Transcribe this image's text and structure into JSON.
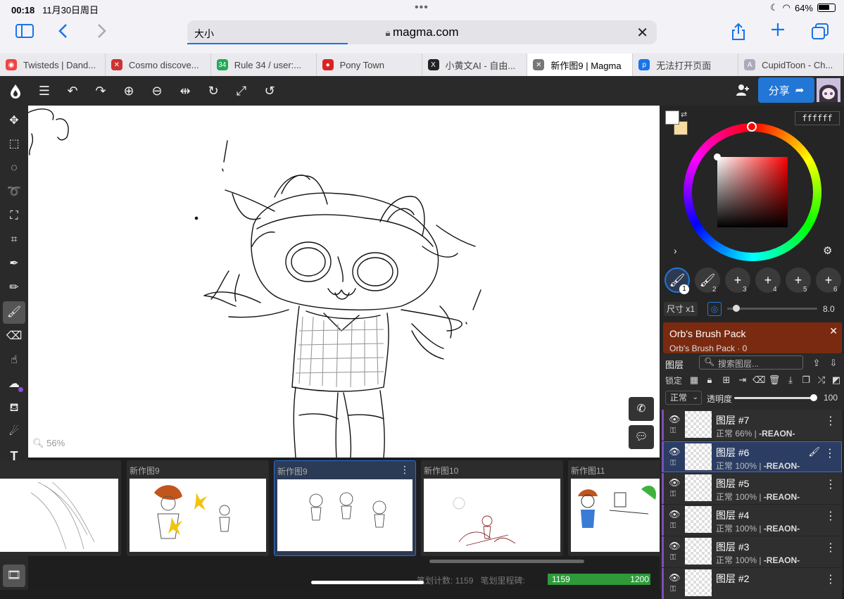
{
  "status": {
    "time": "00:18",
    "date": "11月30日周日",
    "battery": "64%"
  },
  "safari": {
    "url_left": "大小",
    "url": "magma.com",
    "tabs": [
      {
        "title": "Twisteds | Dand...",
        "fav_color": "#e44"
      },
      {
        "title": "Cosmo discove...",
        "fav_color": "#c33"
      },
      {
        "title": "Rule 34 / user:...",
        "fav_color": "#2a5"
      },
      {
        "title": "Pony Town",
        "fav_color": "#d22"
      },
      {
        "title": "小黄文AI - 自由...",
        "fav_color": "#222"
      },
      {
        "title": "新作图9 | Magma",
        "fav_color": "#777"
      },
      {
        "title": "无法打开页面",
        "fav_color": "#1a73e8"
      },
      {
        "title": "CupidToon - Ch...",
        "fav_color": "#aab"
      }
    ],
    "fav_glyphs": [
      "◉",
      "✕",
      "34",
      "●",
      "X",
      "✕",
      "p",
      "A"
    ]
  },
  "app": {
    "share_label": "分享",
    "zoom": "56%",
    "hex_color": "ffffff",
    "size_label": "尺寸 x1",
    "size_value": "8.0",
    "brush_slots": [
      "1",
      "2",
      "3",
      "4",
      "5",
      "6"
    ],
    "ad": {
      "title": "Orb's Brush Pack",
      "subtitle": "Orb's Brush Pack · 0"
    },
    "layers_header": {
      "title": "图层",
      "search_placeholder": "搜索图层...",
      "lock_label": "锁定",
      "blend_mode": "正常",
      "opacity_label": "透明度",
      "opacity_value": "100"
    },
    "layers": [
      {
        "name": "图层 #7",
        "info": "正常 66% | ",
        "owner": "-REAON-"
      },
      {
        "name": "图层 #6",
        "info": "正常 100% | ",
        "owner": "-REAON-"
      },
      {
        "name": "图层 #5",
        "info": "正常 100% | ",
        "owner": "-REAON-"
      },
      {
        "name": "图层 #4",
        "info": "正常 100% | ",
        "owner": "-REAON-"
      },
      {
        "name": "图层 #3",
        "info": "正常 100% | ",
        "owner": "-REAON-"
      },
      {
        "name": "图层 #2",
        "info": "",
        "owner": ""
      }
    ],
    "documents": [
      {
        "title": ""
      },
      {
        "title": "新作图9"
      },
      {
        "title": "新作图9"
      },
      {
        "title": "新作图10"
      },
      {
        "title": "新作图11"
      }
    ],
    "stroke_count_label": "笔划计数: 1159",
    "stroke_milestone_label": "笔划里程碑:",
    "stroke_current": "1159",
    "stroke_max": "1200"
  },
  "colors": {
    "accent": "#2276d6",
    "layer_tag": "#7b4fb5",
    "meter": "#2e9a3a",
    "secondary_swatch": "#f7dca0"
  }
}
